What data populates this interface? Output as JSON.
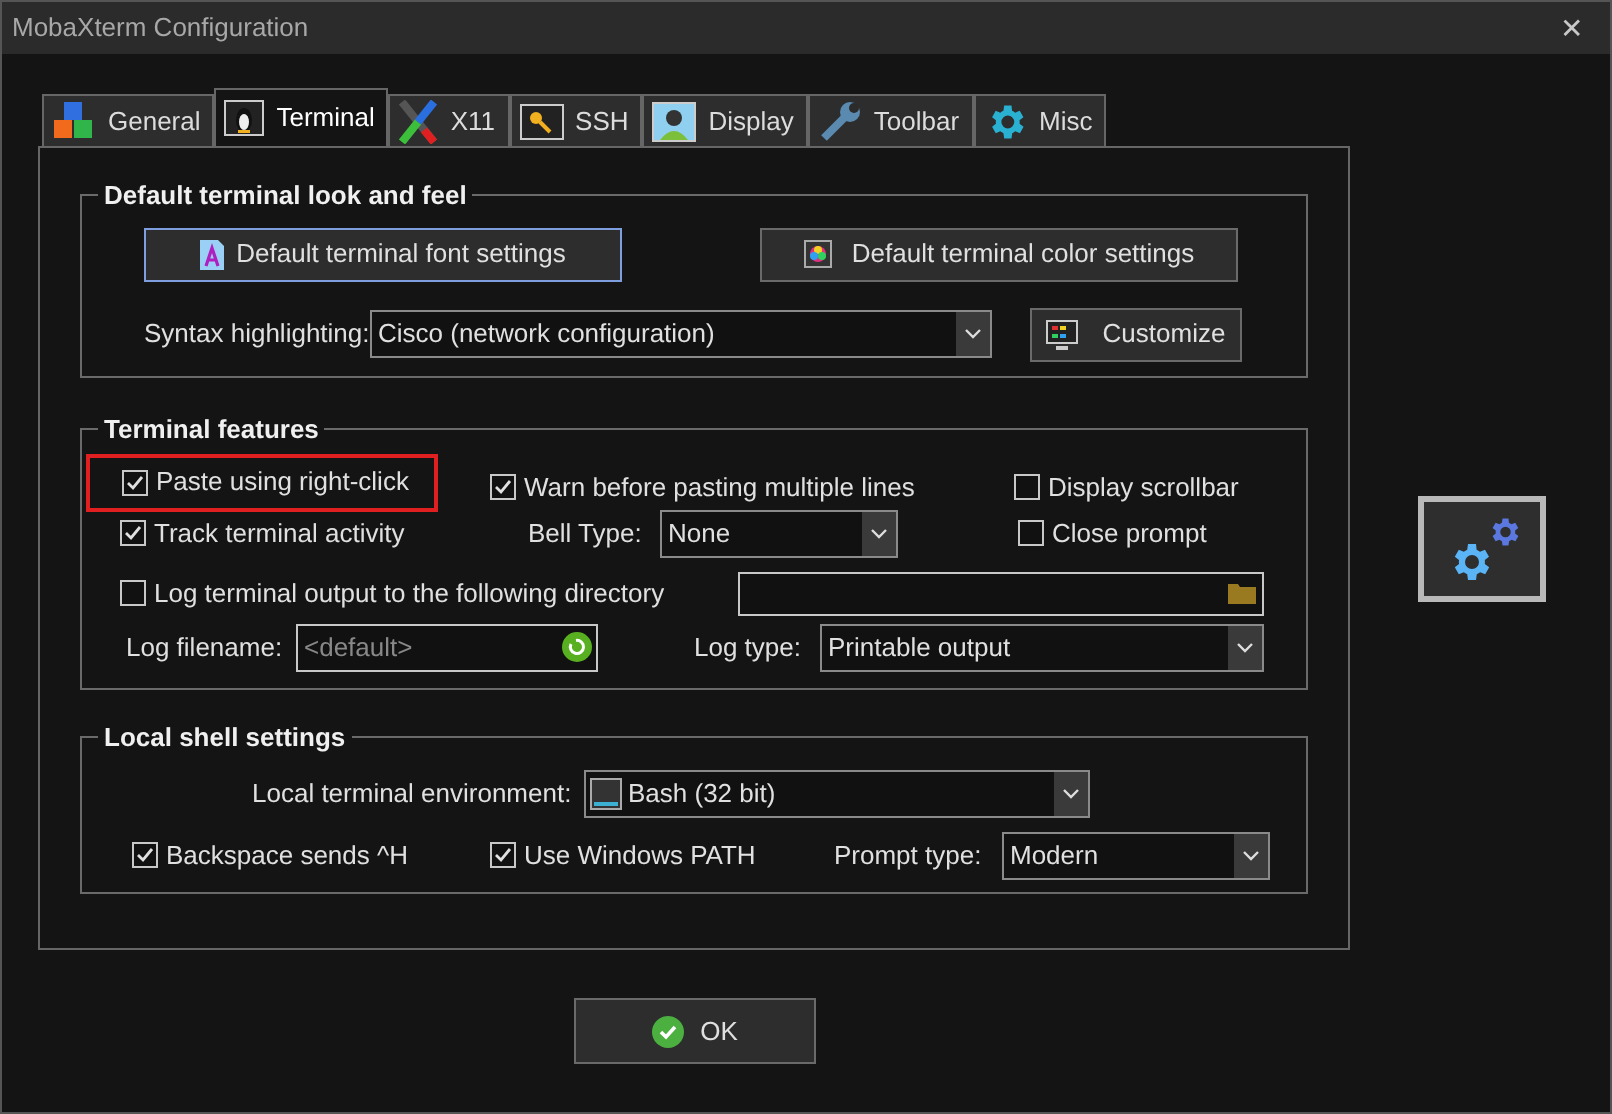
{
  "window": {
    "title": "MobaXterm Configuration",
    "close": "✕"
  },
  "tabs": [
    {
      "label": "General",
      "selected": false
    },
    {
      "label": "Terminal",
      "selected": true
    },
    {
      "label": "X11",
      "selected": false
    },
    {
      "label": "SSH",
      "selected": false
    },
    {
      "label": "Display",
      "selected": false
    },
    {
      "label": "Toolbar",
      "selected": false
    },
    {
      "label": "Misc",
      "selected": false
    }
  ],
  "look_and_feel": {
    "title": "Default terminal look and feel",
    "font_button": "Default terminal font settings",
    "color_button": "Default terminal color settings",
    "syntax_label": "Syntax highlighting:",
    "syntax_value": "Cisco (network configuration)",
    "customize_button": "Customize"
  },
  "features": {
    "title": "Terminal features",
    "paste_right_click": {
      "label": "Paste using right-click",
      "checked": true,
      "highlighted": true
    },
    "warn_paste": {
      "label": "Warn before pasting multiple lines",
      "checked": true
    },
    "display_scrollbar": {
      "label": "Display scrollbar",
      "checked": false
    },
    "track_activity": {
      "label": "Track terminal activity",
      "checked": true
    },
    "bell_label": "Bell Type:",
    "bell_value": "None",
    "close_prompt": {
      "label": "Close prompt",
      "checked": false
    },
    "log_output": {
      "label": "Log terminal output to the following directory",
      "checked": false
    },
    "log_filename_label": "Log filename:",
    "log_filename_placeholder": "<default>",
    "log_type_label": "Log type:",
    "log_type_value": "Printable output"
  },
  "local_shell": {
    "title": "Local shell settings",
    "env_label": "Local terminal environment:",
    "env_value": "Bash (32 bit)",
    "backspace": {
      "label": "Backspace sends ^H",
      "checked": true
    },
    "windows_path": {
      "label": "Use Windows PATH",
      "checked": true
    },
    "prompt_label": "Prompt type:",
    "prompt_value": "Modern"
  },
  "ok_button": "OK"
}
